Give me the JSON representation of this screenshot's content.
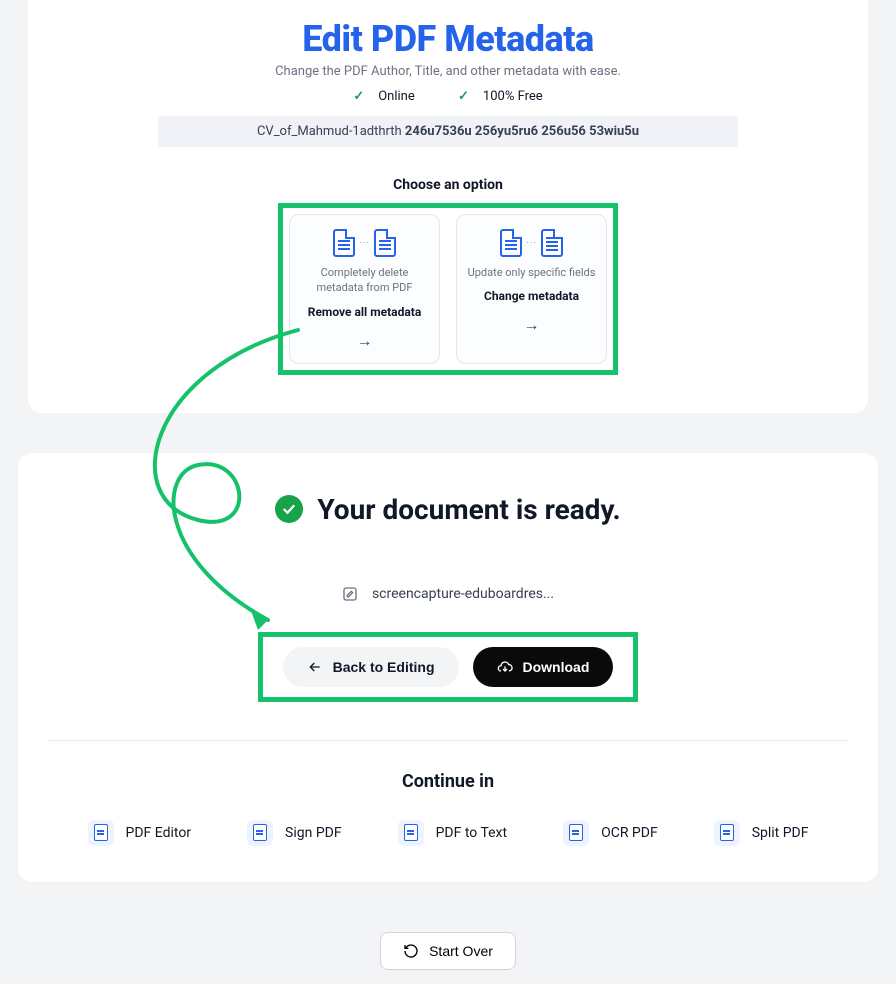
{
  "page": {
    "title": "Edit PDF Metadata",
    "subtitle": "Change the PDF Author, Title, and other metadata with ease.",
    "tags": {
      "online": "Online",
      "free": "100% Free"
    },
    "filename_plain": "CV_of_Mahmud-1adthrth",
    "filename_bold": "246u7536u 256yu5ru6 256u56 53wiu5u",
    "choose_heading": "Choose an option"
  },
  "options": {
    "remove": {
      "desc": "Completely delete metadata from PDF",
      "title": "Remove all metadata"
    },
    "change": {
      "desc": "Update only specific fields",
      "title": "Change metadata"
    }
  },
  "ready": {
    "heading": "Your document is ready.",
    "filename": "screencapture-eduboardres...",
    "back_label": "Back to Editing",
    "download_label": "Download"
  },
  "continue": {
    "heading": "Continue in",
    "tools": [
      {
        "label": "PDF Editor"
      },
      {
        "label": "Sign PDF"
      },
      {
        "label": "PDF to Text"
      },
      {
        "label": "OCR PDF"
      },
      {
        "label": "Split PDF"
      }
    ]
  },
  "start_over": "Start Over"
}
